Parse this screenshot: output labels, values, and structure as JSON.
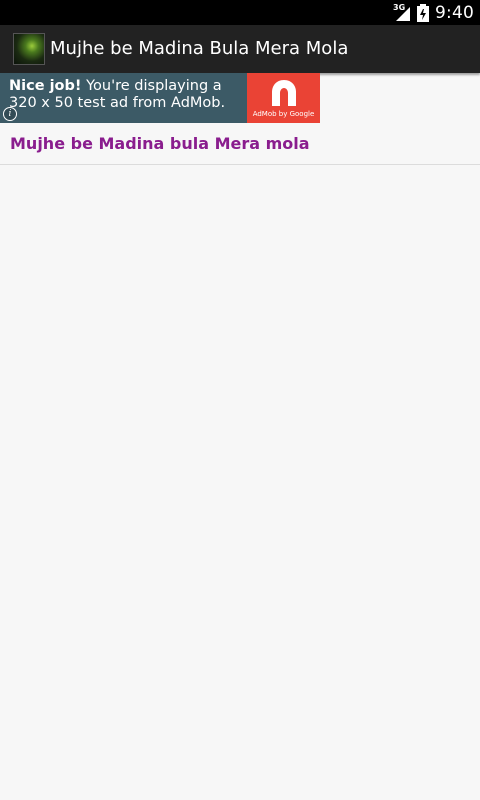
{
  "status_bar": {
    "network_type": "3G",
    "time": "9:40",
    "icons": [
      "signal-icon",
      "battery-icon"
    ]
  },
  "action_bar": {
    "app_icon": "app-logo-icon",
    "title": "Mujhe be Madina Bula Mera Mola"
  },
  "ad": {
    "headline": "Nice job!",
    "body": " You're displaying a 320 x 50 test ad from AdMob.",
    "logo_caption": "AdMob by Google",
    "info_icon": "info-icon",
    "logo_color": "#ea4335",
    "background_color": "#3c5a66"
  },
  "list": {
    "items": [
      {
        "label": "Mujhe be Madina bula Mera mola"
      }
    ]
  },
  "colors": {
    "action_bar": "#222222",
    "list_text": "#8a1d8e",
    "background": "#f7f7f7"
  }
}
